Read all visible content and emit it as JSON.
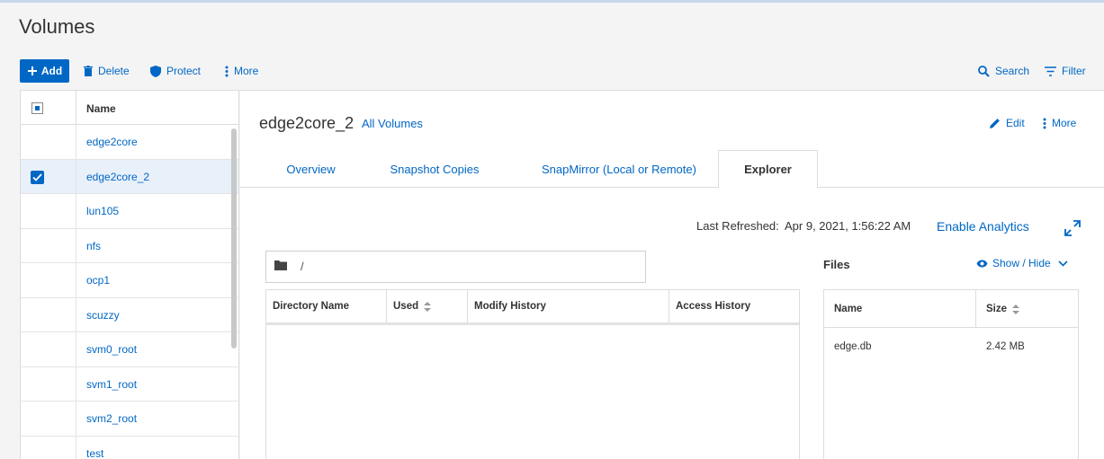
{
  "page": {
    "title": "Volumes"
  },
  "toolbar": {
    "add_label": "Add",
    "delete_label": "Delete",
    "protect_label": "Protect",
    "more_label": "More",
    "search_label": "Search",
    "filter_label": "Filter"
  },
  "volume_list": {
    "header": "Name",
    "items": [
      {
        "name": "edge2core",
        "selected": false
      },
      {
        "name": "edge2core_2",
        "selected": true
      },
      {
        "name": "lun105",
        "selected": false
      },
      {
        "name": "nfs",
        "selected": false
      },
      {
        "name": "ocp1",
        "selected": false
      },
      {
        "name": "scuzzy",
        "selected": false
      },
      {
        "name": "svm0_root",
        "selected": false
      },
      {
        "name": "svm1_root",
        "selected": false
      },
      {
        "name": "svm2_root",
        "selected": false
      },
      {
        "name": "test",
        "selected": false
      }
    ]
  },
  "detail": {
    "title": "edge2core_2",
    "all_volumes_link": "All Volumes",
    "edit_label": "Edit",
    "more_label": "More",
    "tabs": [
      {
        "label": "Overview",
        "active": false
      },
      {
        "label": "Snapshot Copies",
        "active": false
      },
      {
        "label": "SnapMirror (Local or Remote)",
        "active": false
      },
      {
        "label": "Explorer",
        "active": true
      }
    ]
  },
  "explorer": {
    "last_refreshed_label": "Last Refreshed:",
    "last_refreshed_value": "Apr 9, 2021, 1:56:22 AM",
    "enable_analytics": "Enable Analytics",
    "path": "/",
    "directory_table": {
      "columns": [
        "Directory Name",
        "Used",
        "Modify History",
        "Access History"
      ]
    },
    "files": {
      "label": "Files",
      "show_hide": "Show / Hide",
      "columns": [
        "Name",
        "Size"
      ],
      "rows": [
        {
          "name": "edge.db",
          "size": "2.42 MB"
        }
      ]
    }
  },
  "colors": {
    "accent": "#0067c5",
    "selected_row": "#e8f0fa"
  }
}
